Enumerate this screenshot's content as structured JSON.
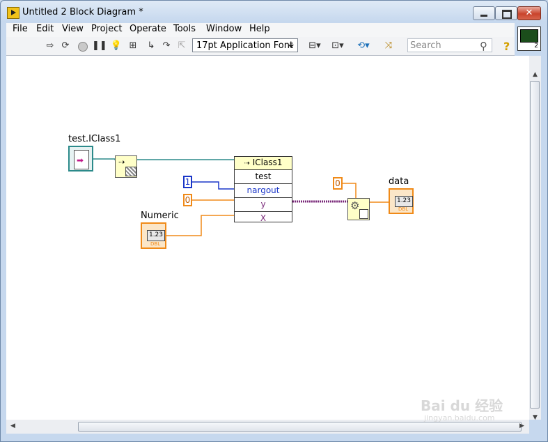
{
  "window": {
    "title": "Untitled 2 Block Diagram *",
    "close_glyph": "✕"
  },
  "menu": [
    "File",
    "Edit",
    "View",
    "Project",
    "Operate",
    "Tools",
    "Window",
    "Help"
  ],
  "toolbar": {
    "font_selector": "17pt Application Font",
    "search_placeholder": "Search",
    "help_glyph": "?"
  },
  "vi_icon": {
    "number": "2"
  },
  "diagram": {
    "class_constant_label": "test.IClass1",
    "property_node": {
      "title": "IClass1",
      "rows": [
        "test",
        "nargout",
        "y",
        "X"
      ]
    },
    "const_nargout": "1",
    "const_y": "0",
    "const_index": "0",
    "numeric_label": "Numeric",
    "numeric_value": "1.23",
    "numeric_type": "DBL",
    "data_label": "data",
    "data_value": "1.23",
    "data_type": "DBL",
    "colors": {
      "class_wire": "#2b8a8a",
      "int_wire": "#1a36c8",
      "dbl_wire": "#f08a18",
      "variant_wire": "#7a2a7a"
    }
  },
  "watermark": {
    "main": "Bai du 经验",
    "sub": "jingyan.baidu.com"
  }
}
